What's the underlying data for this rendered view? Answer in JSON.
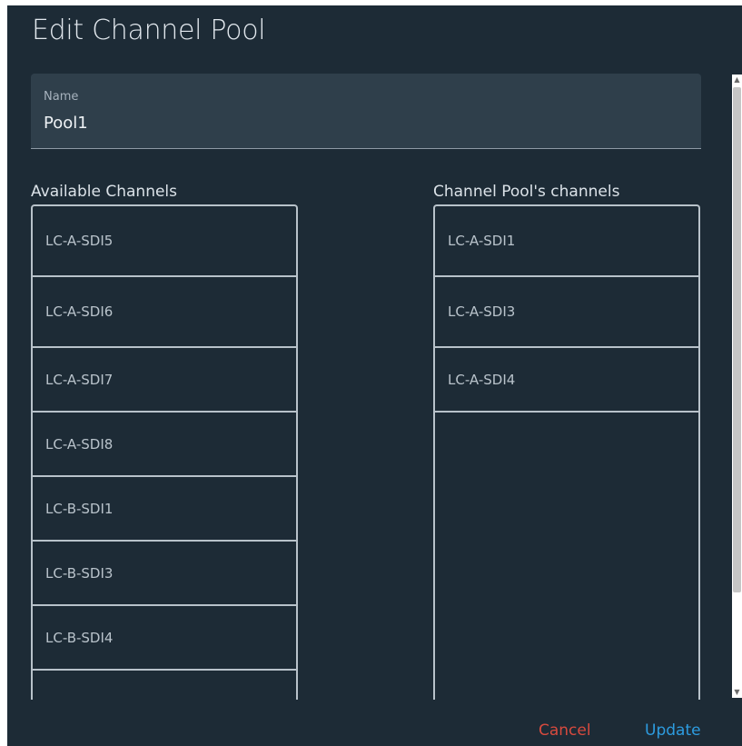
{
  "dialog": {
    "title": "Edit Channel Pool",
    "name_field": {
      "label": "Name",
      "value": "Pool1"
    }
  },
  "available": {
    "header": "Available Channels",
    "items": [
      "LC-A-SDI5",
      "LC-A-SDI6",
      "LC-A-SDI7",
      "LC-A-SDI8",
      "LC-B-SDI1",
      "LC-B-SDI3",
      "LC-B-SDI4",
      ""
    ]
  },
  "pool": {
    "header": "Channel Pool's channels",
    "items": [
      "LC-A-SDI1",
      "LC-A-SDI3",
      "LC-A-SDI4"
    ]
  },
  "actions": {
    "cancel": "Cancel",
    "update": "Update"
  },
  "colors": {
    "background": "#1d2b36",
    "field_bg": "#2f3f4b",
    "cancel": "#d84a3e",
    "update": "#2d9ce0"
  }
}
